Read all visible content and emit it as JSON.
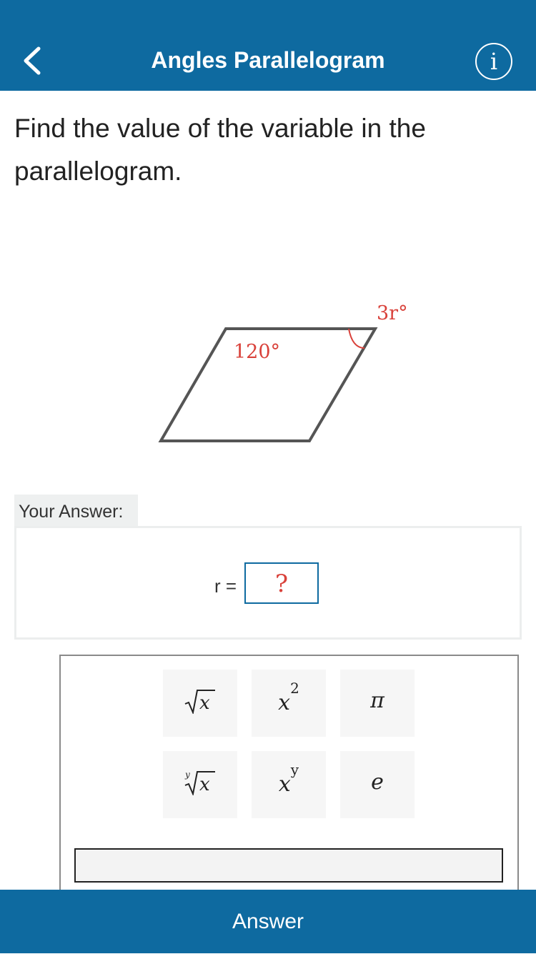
{
  "header": {
    "title": "Angles Parallelogram",
    "back_icon": "chevron-left-icon",
    "info_icon": "info-icon",
    "info_glyph": "i",
    "background_color": "#0e6aa0"
  },
  "question": {
    "text": "Find the value of the variable in the parallelogram."
  },
  "diagram": {
    "angle_top_left": "120°",
    "angle_top_right": "3r°",
    "label_color": "#d9413a",
    "stroke_color": "#555555"
  },
  "answer": {
    "label": "Your Answer:",
    "variable_label": "r =",
    "input_placeholder": "?"
  },
  "keypad": {
    "keys": [
      {
        "name": "sqrt-key",
        "label": "√x"
      },
      {
        "name": "square-key",
        "label": "x²"
      },
      {
        "name": "pi-key",
        "label": "π"
      },
      {
        "name": "nth-root-key",
        "label": "y√x"
      },
      {
        "name": "power-key",
        "label": "xʸ"
      },
      {
        "name": "e-key",
        "label": "e"
      }
    ]
  },
  "footer": {
    "button_label": "Answer"
  }
}
